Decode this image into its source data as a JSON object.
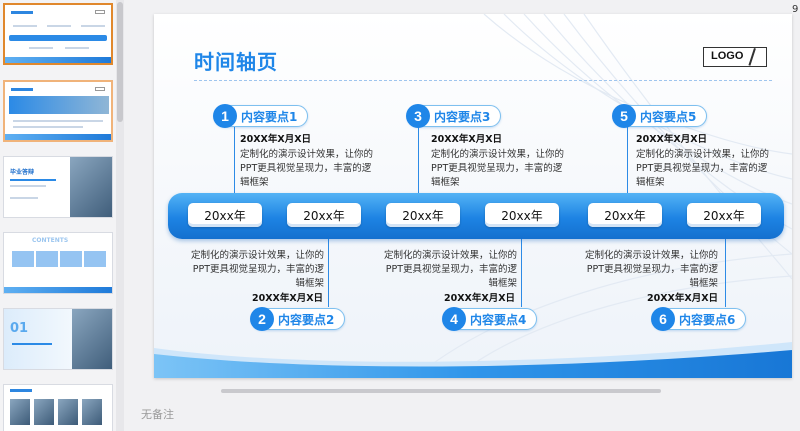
{
  "notes": {
    "placeholder": "无备注"
  },
  "edge": {
    "number": "9"
  },
  "slide": {
    "title": "时间轴页",
    "logo": "LOGO",
    "points": [
      {
        "num": "1",
        "label": "内容要点1",
        "date": "20XX年X月X日",
        "desc": "定制化的演示设计效果，让你的PPT更具视觉呈现力，丰富的逻辑框架"
      },
      {
        "num": "2",
        "label": "内容要点2",
        "date": "20XX年X月X日",
        "desc": "定制化的演示设计效果，让你的PPT更具视觉呈现力，丰富的逻辑框架"
      },
      {
        "num": "3",
        "label": "内容要点3",
        "date": "20XX年X月X日",
        "desc": "定制化的演示设计效果，让你的PPT更具视觉呈现力，丰富的逻辑框架"
      },
      {
        "num": "4",
        "label": "内容要点4",
        "date": "20XX年X月X日",
        "desc": "定制化的演示设计效果，让你的PPT更具视觉呈现力，丰富的逻辑框架"
      },
      {
        "num": "5",
        "label": "内容要点5",
        "date": "20XX年X月X日",
        "desc": "定制化的演示设计效果，让你的PPT更具视觉呈现力，丰富的逻辑框架"
      },
      {
        "num": "6",
        "label": "内容要点6",
        "date": "20XX年X月X日",
        "desc": "定制化的演示设计效果，让你的PPT更具视觉呈现力，丰富的逻辑框架"
      }
    ],
    "years": [
      "20xx年",
      "20xx年",
      "20xx年",
      "20xx年",
      "20xx年",
      "20xx年"
    ]
  },
  "thumbnails": [
    {
      "label": ""
    },
    {
      "label": ""
    },
    {
      "label": "毕业答辩"
    },
    {
      "label": "CONTENTS"
    },
    {
      "label": "01"
    },
    {
      "label": ""
    }
  ],
  "colors": {
    "accent": "#1f86e8",
    "band_light": "#53b3f5",
    "band_dark": "#1470cf",
    "selected_border": "#e0882d"
  }
}
